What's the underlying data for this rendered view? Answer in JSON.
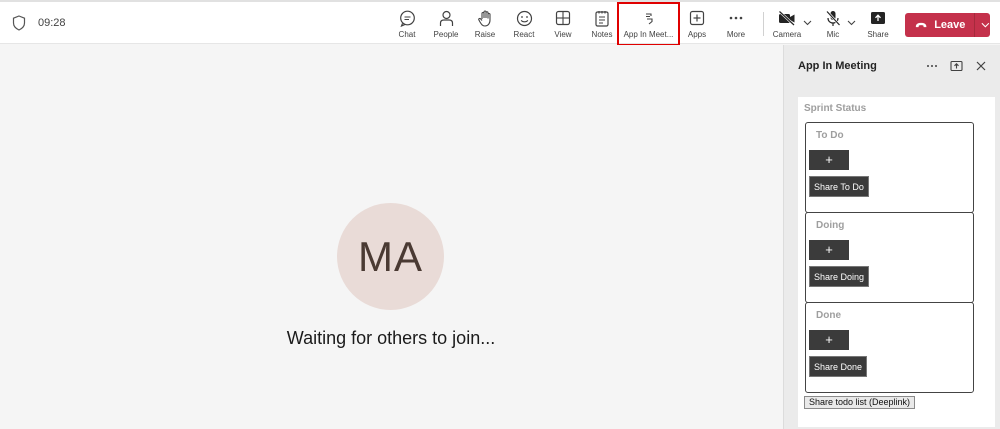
{
  "meeting": {
    "time": "09:28"
  },
  "toolbar": {
    "chat": "Chat",
    "people": "People",
    "raise": "Raise",
    "react": "React",
    "view": "View",
    "notes": "Notes",
    "app_in_meeting": "App In Meet...",
    "apps": "Apps",
    "more": "More",
    "camera": "Camera",
    "mic": "Mic",
    "share": "Share",
    "leave": "Leave"
  },
  "stage": {
    "avatar_initials": "MA",
    "waiting_text": "Waiting for others to join..."
  },
  "panel": {
    "title": "App In Meeting",
    "heading": "Sprint Status",
    "columns": [
      {
        "title": "To Do",
        "add_label": "+",
        "share_label": "Share To Do"
      },
      {
        "title": "Doing",
        "add_label": "+",
        "share_label": "Share Doing"
      },
      {
        "title": "Done",
        "add_label": "+",
        "share_label": "Share Done"
      }
    ],
    "deeplink_button": "Share todo list (Deeplink)"
  },
  "colors": {
    "leave": "#c4314b",
    "highlight": "#e00000",
    "avatar_bg": "#e9dbd7",
    "avatar_text": "#4a3a33"
  }
}
